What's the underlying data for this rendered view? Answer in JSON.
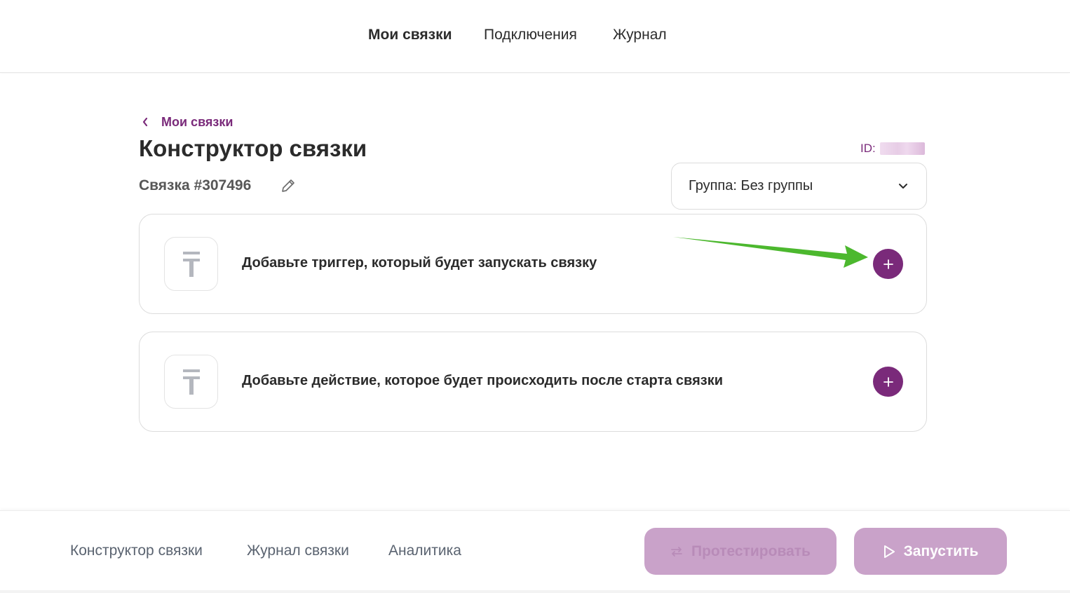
{
  "topnav": {
    "items": [
      {
        "label": "Мои связки",
        "active": true
      },
      {
        "label": "Подключения",
        "active": false
      },
      {
        "label": "Журнал",
        "active": false
      }
    ]
  },
  "breadcrumb": {
    "label": "Мои связки",
    "icon": "chevron-left-icon"
  },
  "page": {
    "title": "Конструктор связки",
    "id_label": "ID:",
    "id_value": "",
    "subtitle": "Связка #307496",
    "edit_icon": "pencil-icon"
  },
  "group_select": {
    "value": "Группа: Без группы",
    "icon": "chevron-down-icon"
  },
  "cards": [
    {
      "text": "Добавьте триггер, который будет запускать связку",
      "icon": "placeholder-service-icon",
      "button_icon": "plus-icon"
    },
    {
      "text": "Добавьте действие, которое будет происходить после старта связки",
      "icon": "placeholder-service-icon",
      "button_icon": "plus-icon"
    }
  ],
  "annotation": {
    "icon": "green-arrow-icon",
    "color": "#4cb82e"
  },
  "bottombar": {
    "tabs": [
      "Конструктор связки",
      "Журнал связки",
      "Аналитика"
    ],
    "test_button": {
      "label": "Протестировать",
      "icon": "swap-arrows-icon"
    },
    "run_button": {
      "label": "Запустить",
      "icon": "play-icon"
    }
  },
  "colors": {
    "accent": "#7a2a7a",
    "button_disabled_bg": "#c9a2c9",
    "text": "#2b2b2b",
    "muted_text": "#5a6370"
  }
}
